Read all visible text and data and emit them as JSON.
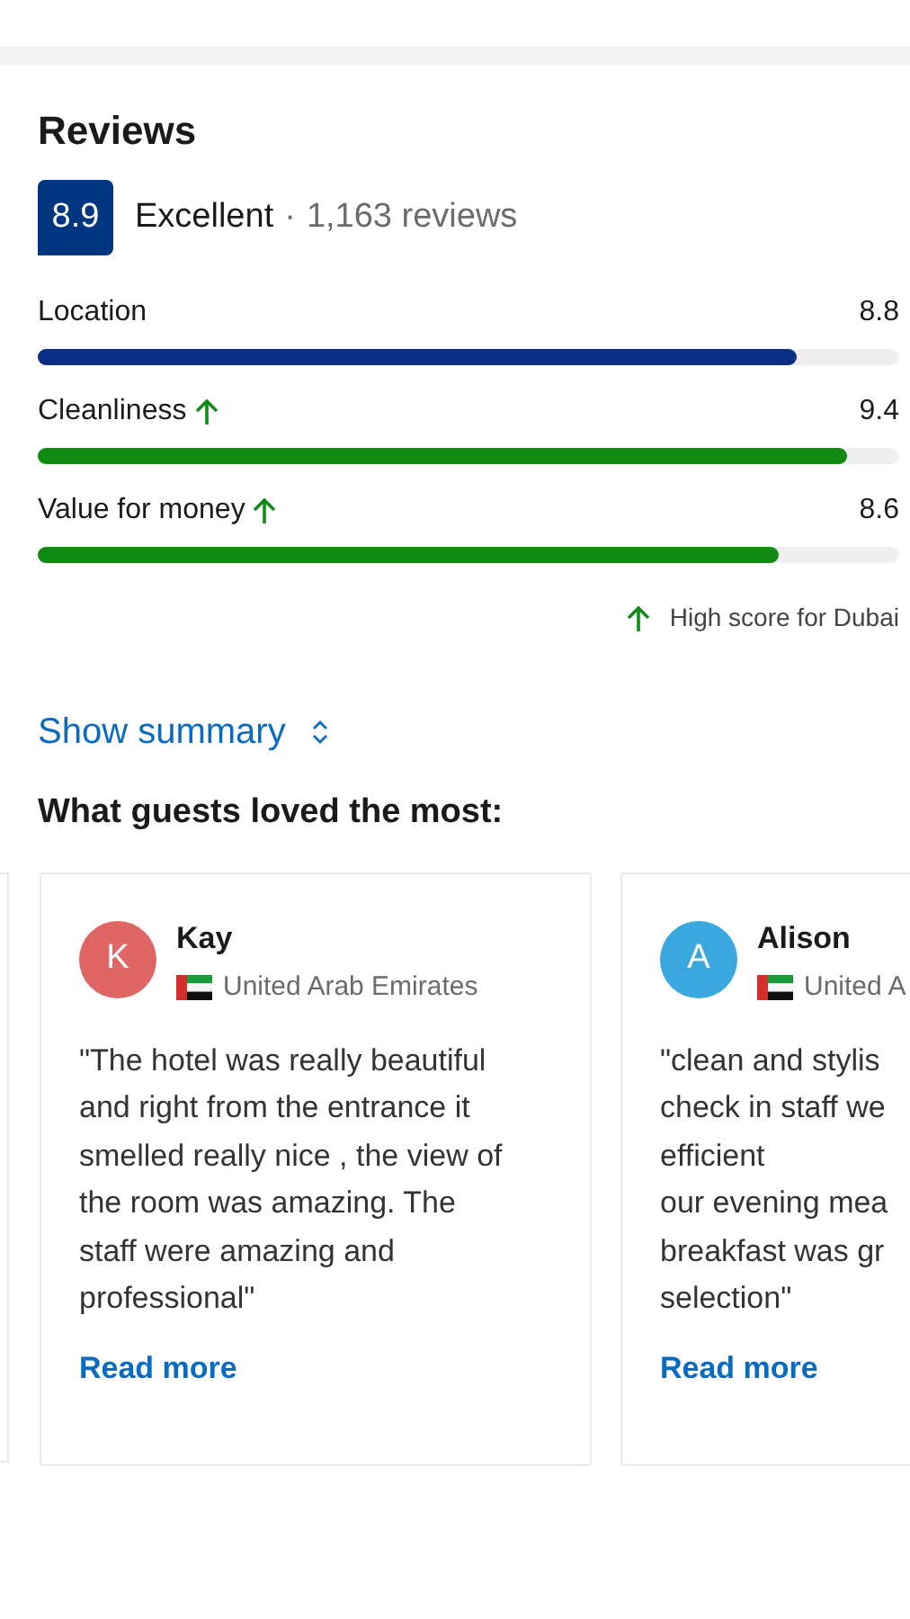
{
  "title": "Reviews",
  "score": {
    "value": "8.9",
    "rating": "Excellent",
    "separator": "·",
    "count": "1,163 reviews"
  },
  "categories": [
    {
      "label": "Location",
      "score": "8.8",
      "level": 0.88,
      "high": false
    },
    {
      "label": "Cleanliness",
      "score": "9.4",
      "level": 0.94,
      "high": true
    },
    {
      "label": "Value for money",
      "score": "8.6",
      "level": 0.86,
      "high": true
    }
  ],
  "high_score_note": "High score for Dubai",
  "summary_link": "Show summary",
  "loved_heading": "What guests loved the most:",
  "reviews": [
    {
      "initial": "K",
      "color": "#e06666",
      "name": "Kay",
      "country": "United Arab Emirates",
      "text": "\"The hotel was really beautiful\nand right from the entrance it\nsmelled really nice , the view of\nthe room was amazing. The\nstaff were amazing and\nprofessional\"",
      "link": "Read more"
    },
    {
      "initial": "A",
      "color": "#3aa8de",
      "name": "Alison",
      "country": "United A",
      "text": "\"clean and stylis\ncheck in staff we\nefficient\nour evening mea\nbreakfast was gr\nselection\"",
      "link": "Read more"
    }
  ]
}
